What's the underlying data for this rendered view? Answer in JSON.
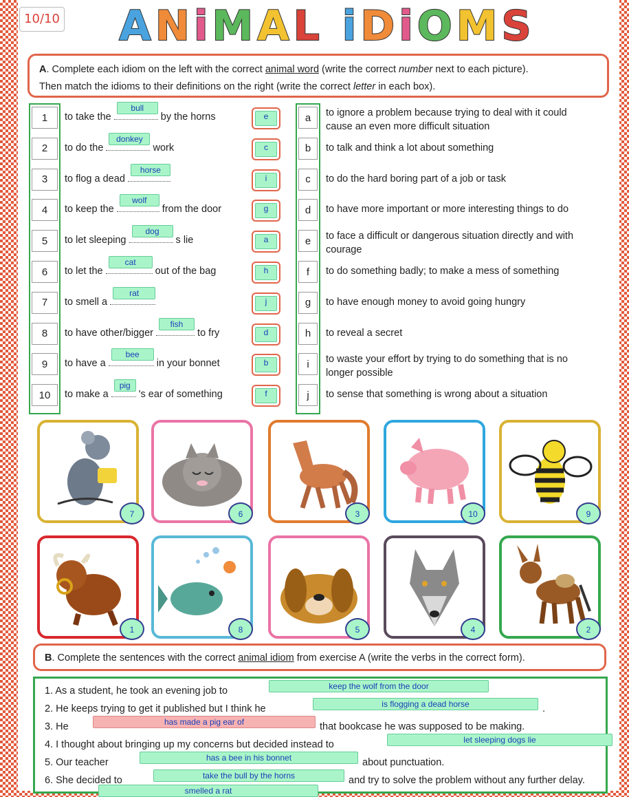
{
  "score": "10/10",
  "title": "ANiMAL iDiOMS",
  "sectionA": {
    "letter": "A",
    "text1": ". Complete each idiom on the left with the correct ",
    "underline1": "animal word",
    "text2": " (write the correct ",
    "italic1": "number",
    "text3": " next to each  picture).",
    "text4": "Then match the idioms to their definitions on the right (write the correct ",
    "italic2": "letter",
    "text5": " in each box)."
  },
  "idioms": [
    {
      "num": "1",
      "pre": "to take the",
      "word": "bull",
      "post": "by the horns",
      "match": "e"
    },
    {
      "num": "2",
      "pre": "to do the",
      "word": "donkey",
      "post": "work",
      "match": "c"
    },
    {
      "num": "3",
      "pre": "to flog a dead",
      "word": "horse",
      "post": "",
      "match": "i"
    },
    {
      "num": "4",
      "pre": "to keep the",
      "word": "wolf",
      "post": "from the door",
      "match": "g"
    },
    {
      "num": "5",
      "pre": "to let sleeping",
      "word": "dog",
      "post": "s lie",
      "match": "a"
    },
    {
      "num": "6",
      "pre": "to let the",
      "word": "cat",
      "post": "out of the bag",
      "match": "h"
    },
    {
      "num": "7",
      "pre": "to smell a",
      "word": "rat",
      "post": "",
      "match": "j"
    },
    {
      "num": "8",
      "pre": "to have other/bigger",
      "word": "fish",
      "post": "to fry",
      "match": "d"
    },
    {
      "num": "9",
      "pre": "to have a",
      "word": "bee",
      "post": "in your bonnet",
      "match": "b"
    },
    {
      "num": "10",
      "pre": "to make a",
      "word": "pig",
      "post": "'s ear of something",
      "match": "f"
    }
  ],
  "definitions": [
    {
      "letter": "a",
      "line1": "to ignore a problem because trying to deal with it could",
      "line2": "cause an even more difficult situation"
    },
    {
      "letter": "b",
      "line1": "to talk and think a lot about something",
      "line2": ""
    },
    {
      "letter": "c",
      "line1": "to do the hard boring part of a job or task",
      "line2": ""
    },
    {
      "letter": "d",
      "line1": "to have more important or more interesting things to do",
      "line2": ""
    },
    {
      "letter": "e",
      "line1": "to face a difficult or dangerous situation directly and with",
      "line2": "courage"
    },
    {
      "letter": "f",
      "line1": "to do something badly; to make a mess of something",
      "line2": ""
    },
    {
      "letter": "g",
      "line1": "to have enough money to avoid going hungry",
      "line2": ""
    },
    {
      "letter": "h",
      "line1": "to reveal a secret",
      "line2": ""
    },
    {
      "letter": "i",
      "line1": "to waste your effort by trying to do something that is no",
      "line2": "longer possible"
    },
    {
      "letter": "j",
      "line1": "to sense that something is wrong about a situation",
      "line2": ""
    }
  ],
  "pictures": [
    {
      "animal": "rat",
      "answer": "7",
      "color": "#d9b233"
    },
    {
      "animal": "cat",
      "answer": "6",
      "color": "#ea74a6"
    },
    {
      "animal": "horse",
      "answer": "3",
      "color": "#e07b2e"
    },
    {
      "animal": "pig",
      "answer": "10",
      "color": "#2fa7df"
    },
    {
      "animal": "bee",
      "answer": "9",
      "color": "#d9b233"
    },
    {
      "animal": "bull",
      "answer": "1",
      "color": "#d9282e"
    },
    {
      "animal": "fish",
      "answer": "8",
      "color": "#58b8d6"
    },
    {
      "animal": "dog",
      "answer": "5",
      "color": "#ea74a6"
    },
    {
      "animal": "wolf",
      "answer": "4",
      "color": "#5a4a5c"
    },
    {
      "animal": "donkey",
      "answer": "2",
      "color": "#35a84e"
    }
  ],
  "sectionB": {
    "letter": "B",
    "text1": ". Complete the sentences with the correct ",
    "underline1": "animal idiom",
    "text2": " from exercise A (write the verbs in the correct form)."
  },
  "sentences": [
    {
      "pre": "1. As a student, he took an evening job to",
      "answer": "keep the wolf from the door",
      "post": "",
      "wrong": false
    },
    {
      "pre": "2. He keeps trying to get it published but I think he",
      "answer": "is flogging a dead horse",
      "post": ".",
      "wrong": false
    },
    {
      "pre": "3. He",
      "answer": "has made a pig ear of",
      "post": "that bookcase he was supposed to be making.",
      "wrong": true
    },
    {
      "pre": "4. I thought about bringing up my concerns but decided instead to",
      "answer": "let sleeping dogs lie",
      "post": "",
      "wrong": false
    },
    {
      "pre": "5. Our teacher",
      "answer": "has a bee in his bonnet",
      "post": "about punctuation.",
      "wrong": false
    },
    {
      "pre": "6. She decided to",
      "answer": "take the bull by the horns",
      "post": "and try to solve the problem without any further delay.",
      "wrong": false
    },
    {
      "pre": "",
      "answer": "smelled a rat",
      "post": "",
      "wrong": false
    }
  ]
}
